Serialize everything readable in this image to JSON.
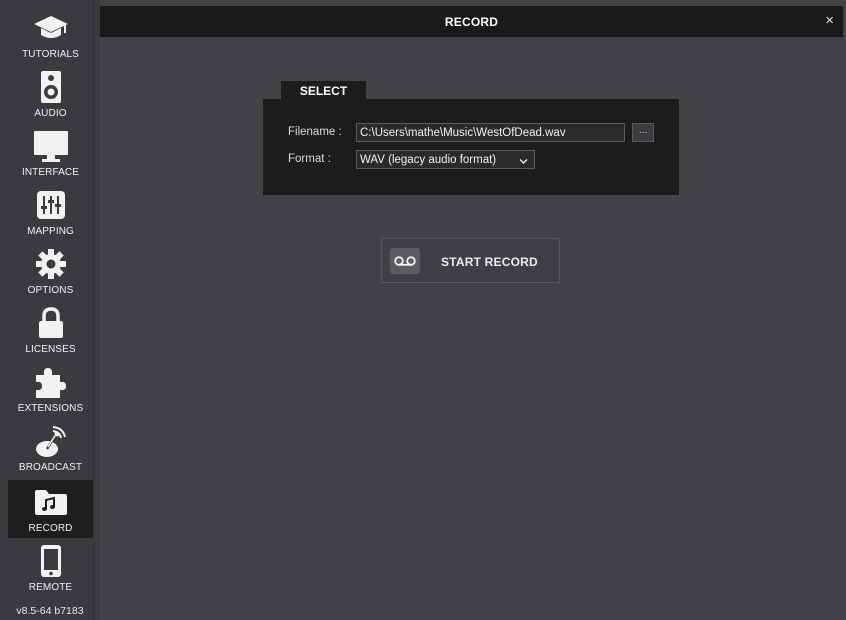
{
  "window": {
    "title": "RECORD",
    "close_label": "×"
  },
  "sidebar": {
    "items": [
      {
        "label": "TUTORIALS",
        "icon": "graduation-cap-icon"
      },
      {
        "label": "AUDIO",
        "icon": "speaker-icon"
      },
      {
        "label": "INTERFACE",
        "icon": "monitor-icon"
      },
      {
        "label": "MAPPING",
        "icon": "sliders-icon"
      },
      {
        "label": "OPTIONS",
        "icon": "gear-icon"
      },
      {
        "label": "LICENSES",
        "icon": "lock-icon"
      },
      {
        "label": "EXTENSIONS",
        "icon": "puzzle-icon"
      },
      {
        "label": "BROADCAST",
        "icon": "broadcast-icon"
      },
      {
        "label": "RECORD",
        "icon": "music-folder-icon",
        "active": true
      },
      {
        "label": "REMOTE",
        "icon": "phone-icon"
      }
    ],
    "version": "v8.5-64 b7183"
  },
  "select_panel": {
    "tab_label": "SELECT",
    "filename_label": "Filename :",
    "filename_value": "C:\\Users\\mathe\\Music\\WestOfDead.wav",
    "browse_label": "...",
    "format_label": "Format :",
    "format_value": "WAV (legacy audio format)"
  },
  "record_button": {
    "label": "START RECORD",
    "icon": "voicemail-icon"
  },
  "colors": {
    "background": "#434347",
    "sidebar": "#3b3b3f",
    "titlebar": "#1a1a1b",
    "panel": "#1c1c1d",
    "active_item": "#1e1e1f"
  }
}
